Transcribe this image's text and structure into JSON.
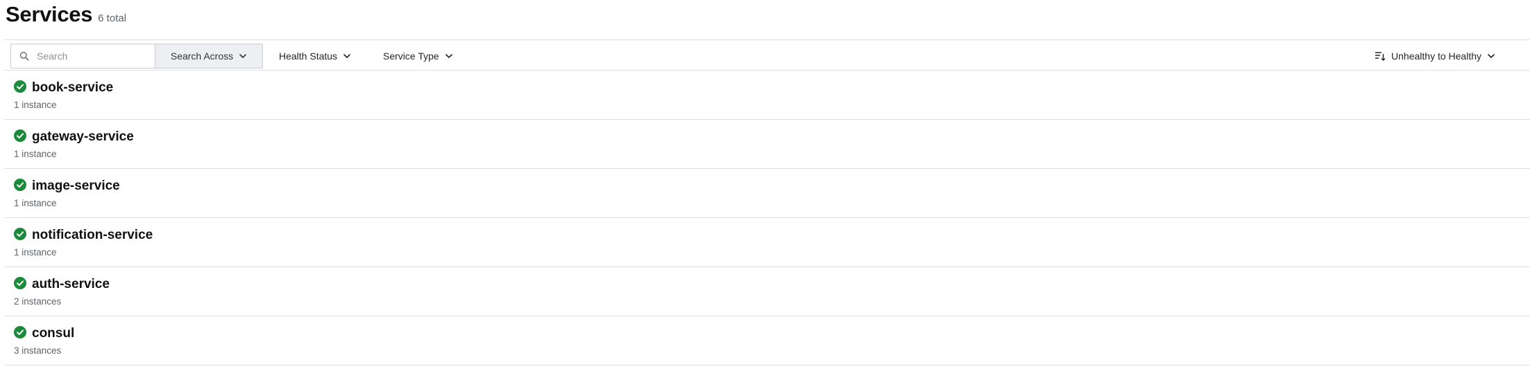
{
  "header": {
    "title": "Services",
    "total": "6 total"
  },
  "toolbar": {
    "search_placeholder": "Search",
    "search_across_label": "Search Across",
    "health_status_label": "Health Status",
    "service_type_label": "Service Type",
    "sort_label": "Unhealthy to Healthy"
  },
  "services": [
    {
      "name": "book-service",
      "instances": "1 instance",
      "status": "healthy"
    },
    {
      "name": "gateway-service",
      "instances": "1 instance",
      "status": "healthy"
    },
    {
      "name": "image-service",
      "instances": "1 instance",
      "status": "healthy"
    },
    {
      "name": "notification-service",
      "instances": "1 instance",
      "status": "healthy"
    },
    {
      "name": "auth-service",
      "instances": "2 instances",
      "status": "healthy"
    },
    {
      "name": "consul",
      "instances": "3 instances",
      "status": "healthy"
    }
  ],
  "colors": {
    "healthy": "#1b8a3a",
    "divider": "#dcdee2",
    "muted_text": "#5f6368"
  },
  "icons": {
    "search": "search-icon",
    "chevron": "chevron-down-icon",
    "sort": "sort-icon",
    "status": "check-circle-icon"
  }
}
